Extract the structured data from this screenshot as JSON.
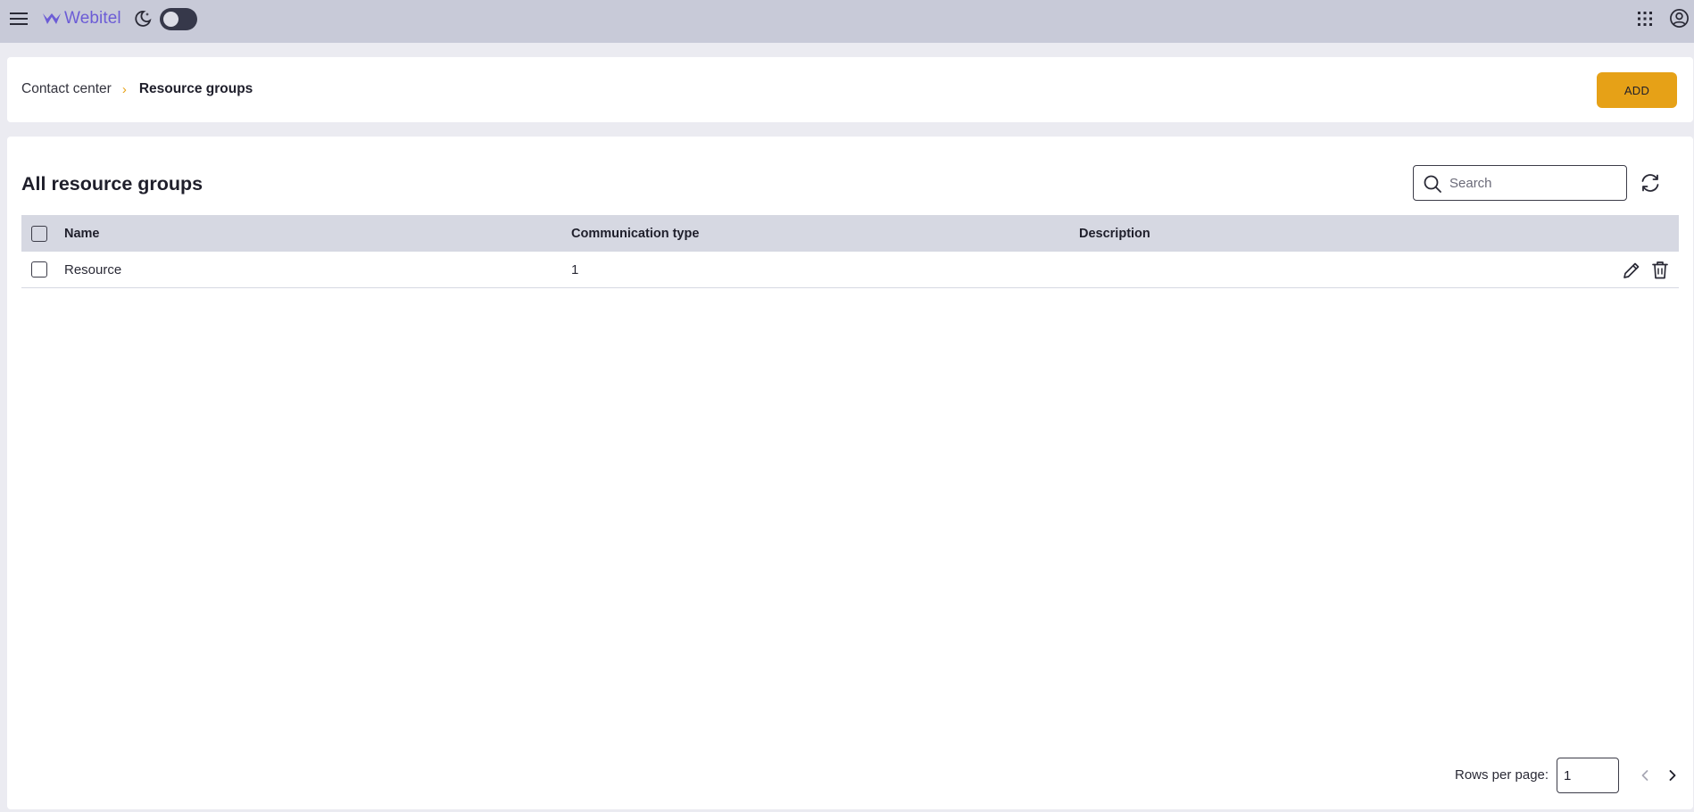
{
  "header": {
    "logo_text": "Webitel",
    "theme_toggle": "dark-mode-off"
  },
  "breadcrumb": {
    "parent": "Contact center",
    "separator": "›",
    "current": "Resource groups"
  },
  "toolbar": {
    "add_label": "ADD"
  },
  "main": {
    "title": "All resource groups",
    "search_placeholder": "Search"
  },
  "table": {
    "columns": [
      "Name",
      "Communication type",
      "Description"
    ],
    "rows": [
      {
        "name": "Resource",
        "communication_type": "1",
        "description": ""
      }
    ]
  },
  "pagination": {
    "rows_per_page_label": "Rows per page:",
    "rows_per_page_value": "1"
  },
  "colors": {
    "header_bg": "#c8cad8",
    "accent": "#e6a117",
    "brand": "#6c5cd6",
    "table_header_bg": "#d6d8e2"
  }
}
